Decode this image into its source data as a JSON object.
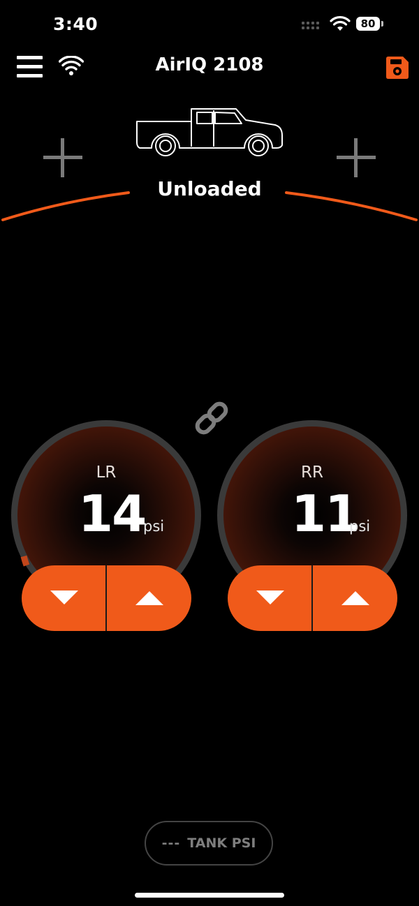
{
  "status_bar": {
    "time": "3:40",
    "battery": "80"
  },
  "header": {
    "title": "AirIQ 2108"
  },
  "preset": {
    "label": "Unloaded"
  },
  "gauges": [
    {
      "name": "LR",
      "value": "14",
      "unit": "psi",
      "level": 0.02
    },
    {
      "name": "RR",
      "value": "11",
      "unit": "psi",
      "level": 0.0
    }
  ],
  "tank": {
    "value": "---",
    "label": "TANK PSI"
  },
  "icons": {
    "menu": "hamburger-menu-icon",
    "wifi": "wifi-icon",
    "save": "save-disk-icon",
    "truck": "pickup-truck-icon",
    "link": "chain-link-icon",
    "up": "triangle-up-icon",
    "down": "triangle-down-icon",
    "add": "plus-icon"
  },
  "colors": {
    "accent": "#f05a1a",
    "background": "#000000",
    "gauge_ring": "#3a3a3a"
  }
}
